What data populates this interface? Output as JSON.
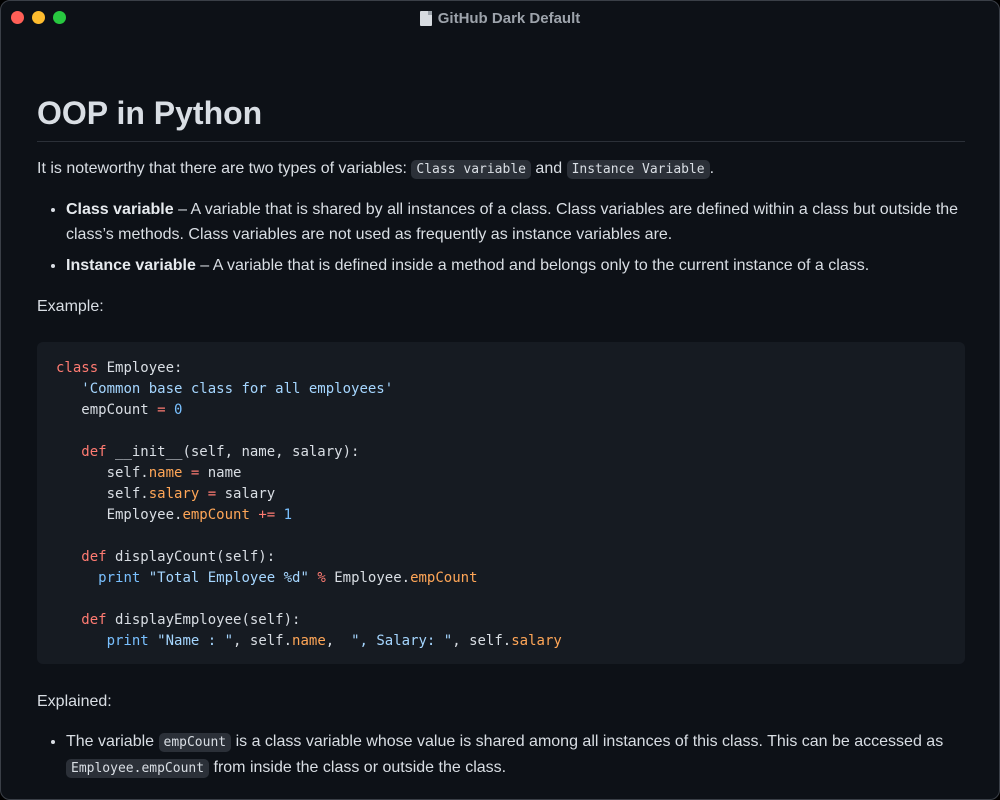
{
  "window": {
    "title": "GitHub Dark Default"
  },
  "doc": {
    "heading": "OOP in Python",
    "intro_before": "It is noteworthy that there are two types of variables: ",
    "intro_code1": "Class variable",
    "intro_middle": " and ",
    "intro_code2": "Instance Variable",
    "intro_after": ".",
    "bullets": [
      {
        "term": "Class variable",
        "text": " – A variable that is shared by all instances of a class. Class variables are defined within a class but outside the class’s methods. Class variables are not used as frequently as instance variables are."
      },
      {
        "term": "Instance variable",
        "text": " – A variable that is defined inside a method and belongs only to the current instance of a class."
      }
    ],
    "example_label": "Example:",
    "explained_label": "Explained:",
    "explained_bullet": {
      "before": "The variable ",
      "code1": "empCount",
      "middle": " is a class variable whose value is shared among all instances of this class. This can be accessed as ",
      "code2": "Employee.empCount",
      "after": " from inside the class or outside the class."
    }
  },
  "code_lines": [
    "class Employee:",
    "   'Common base class for all employees'",
    "   empCount = 0",
    "",
    "   def __init__(self, name, salary):",
    "      self.name = name",
    "      self.salary = salary",
    "      Employee.empCount += 1",
    "",
    "   def displayCount(self):",
    "     print \"Total Employee %d\" % Employee.empCount",
    "",
    "   def displayEmployee(self):",
    "      print \"Name : \", self.name,  \", Salary: \", self.salary"
  ],
  "colors": {
    "background": "#0d1117",
    "code_background": "#161b22",
    "keyword": "#ff7b72",
    "string": "#a5d6ff",
    "number": "#79c0ff",
    "attribute": "#ffa657"
  }
}
